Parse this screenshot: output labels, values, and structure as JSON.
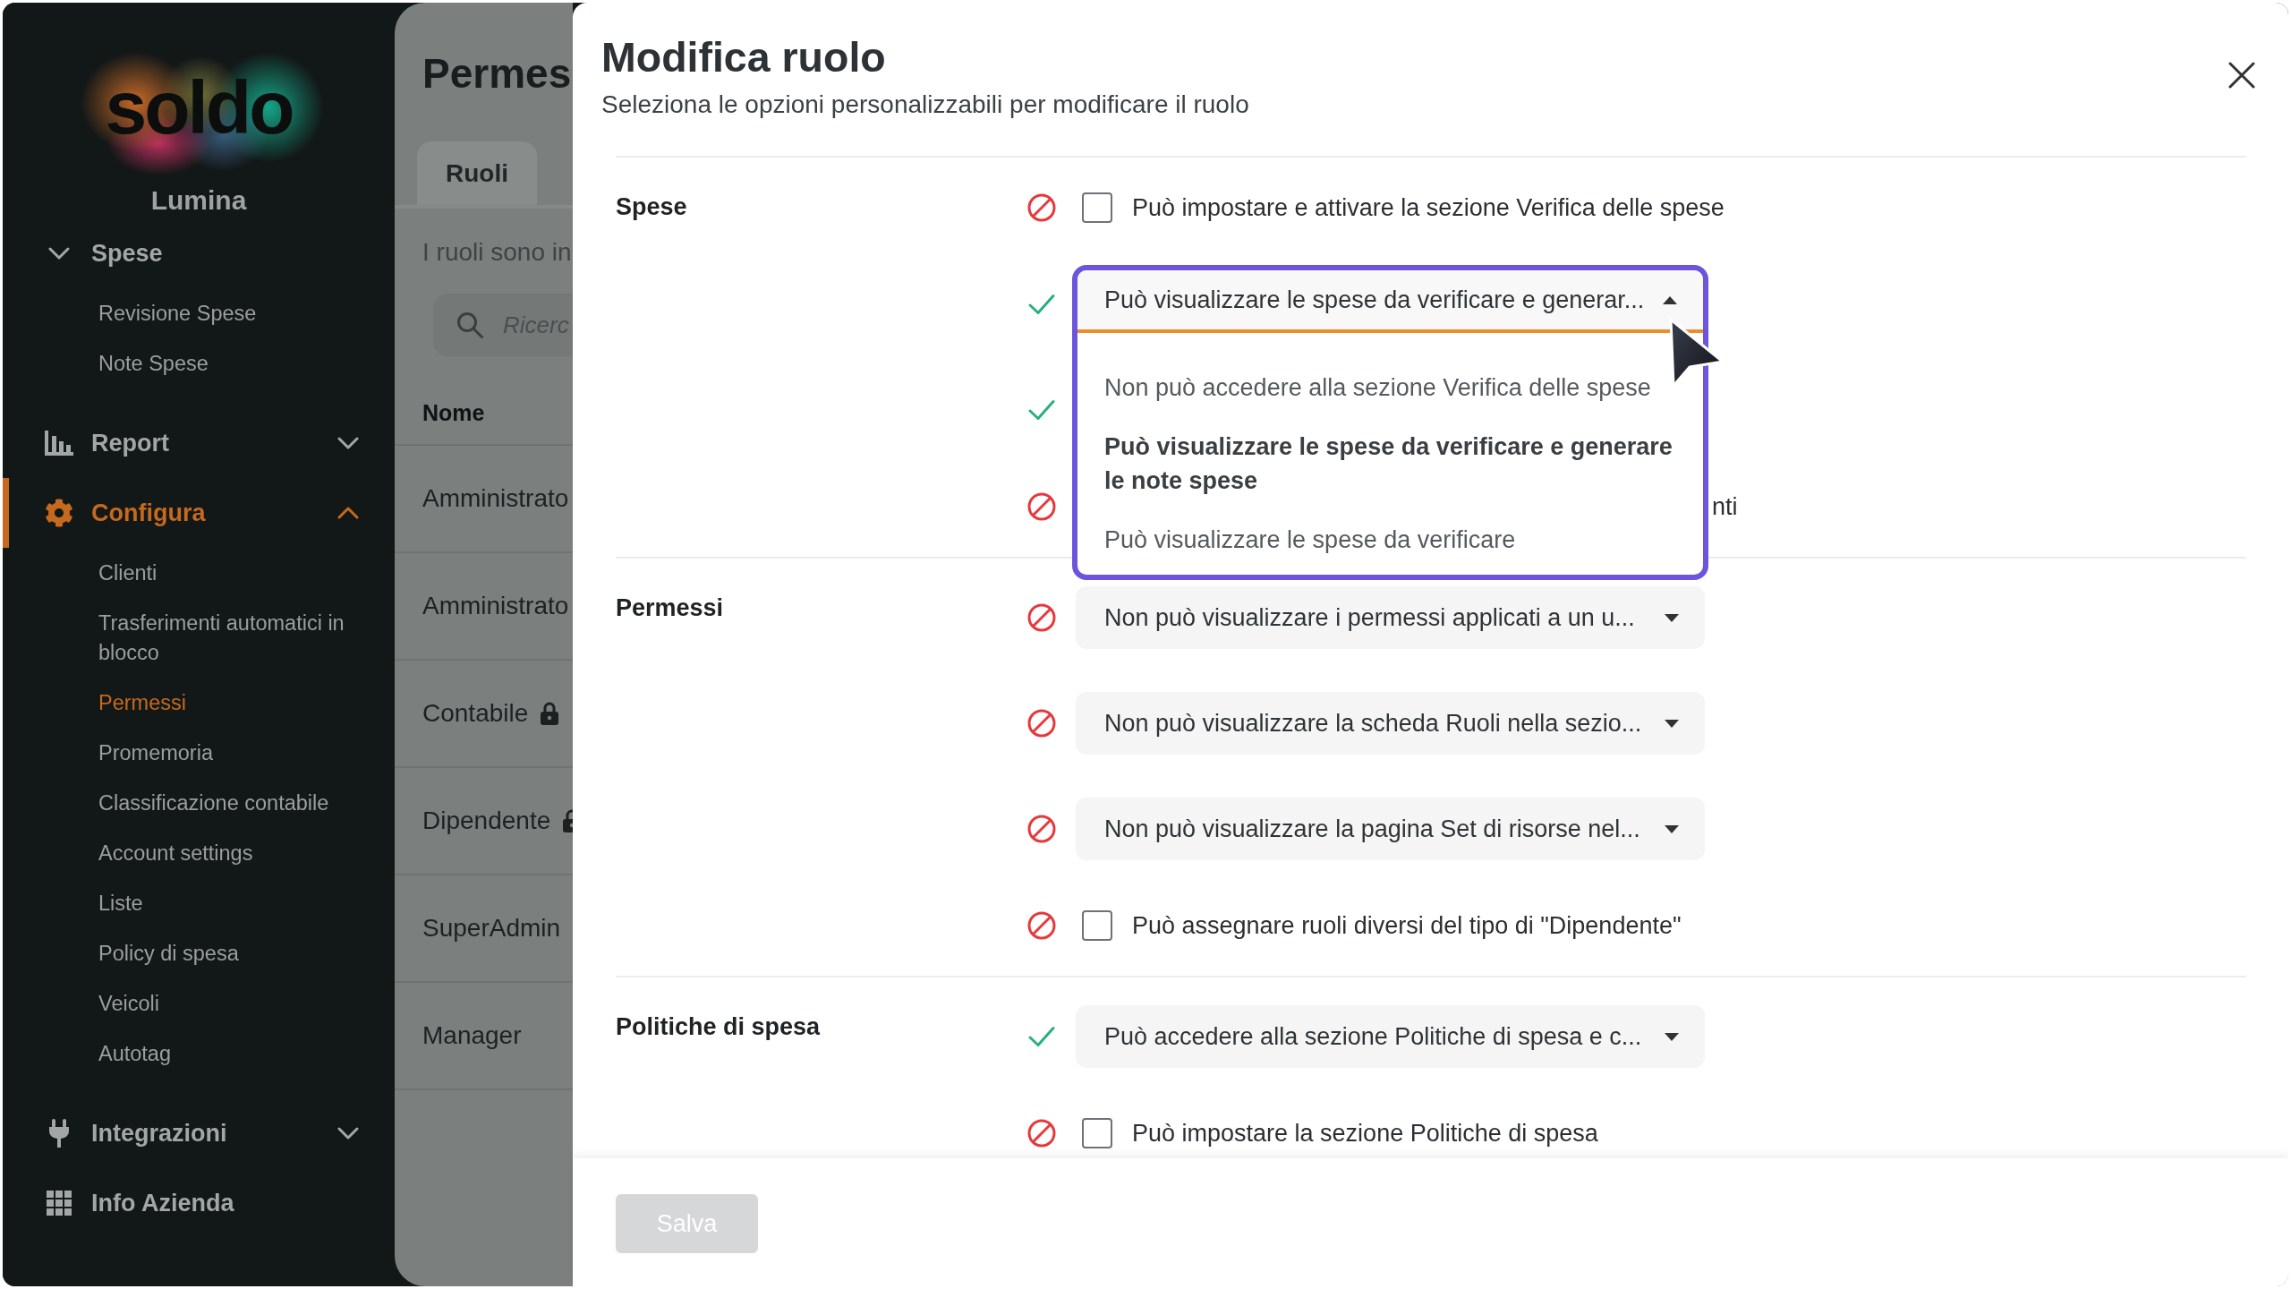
{
  "sidebar": {
    "logo": "soldo",
    "company": "Lumina",
    "groups": [
      {
        "label": "Spese",
        "selected": false,
        "children": [
          {
            "label": "Revisione Spese",
            "selected": false
          },
          {
            "label": "Note Spese",
            "selected": false
          }
        ]
      },
      {
        "label": "Report",
        "selected": false,
        "expanded": false
      },
      {
        "label": "Configura",
        "selected": true,
        "expanded": true,
        "children": [
          {
            "label": "Clienti",
            "selected": false
          },
          {
            "label": "Trasferimenti automatici in blocco",
            "selected": false
          },
          {
            "label": "Permessi",
            "selected": true
          },
          {
            "label": "Promemoria",
            "selected": false
          },
          {
            "label": "Classificazione contabile",
            "selected": false
          },
          {
            "label": "Account settings",
            "selected": false
          },
          {
            "label": "Liste",
            "selected": false
          },
          {
            "label": "Policy di spesa",
            "selected": false
          },
          {
            "label": "Veicoli",
            "selected": false
          },
          {
            "label": "Autotag",
            "selected": false
          }
        ]
      },
      {
        "label": "Integrazioni",
        "selected": false,
        "expanded": false
      },
      {
        "label": "Info Azienda",
        "selected": false
      }
    ]
  },
  "page": {
    "title": "Permes",
    "tabs": [
      {
        "label": "Ruoli",
        "selected": true
      }
    ],
    "description": "I ruoli sono in",
    "search": {
      "placeholder": "Ricerc"
    },
    "table": {
      "columns": [
        "Nome"
      ],
      "rows": [
        {
          "name": "Amministrato",
          "locked": false
        },
        {
          "name": "Amministrato",
          "locked": false
        },
        {
          "name": "Contabile",
          "locked": true
        },
        {
          "name": "Dipendente",
          "locked": true
        },
        {
          "name": "SuperAdmin",
          "locked": false
        },
        {
          "name": "Manager",
          "locked": false
        }
      ]
    }
  },
  "dialog": {
    "title": "Modifica ruolo",
    "subtitle": "Seleziona le opzioni personalizzabili per modificare il ruolo",
    "sections": [
      {
        "label": "Spese",
        "rows": [
          {
            "kind": "checkbox",
            "allowed": false,
            "checked": false,
            "label": "Può impostare e attivare la sezione Verifica delle spese"
          },
          {
            "kind": "select",
            "allowed": true,
            "open": true,
            "value": "Può visualizzare le spese da verificare e generar...",
            "options": [
              {
                "label": "Non può accedere alla sezione Verifica delle spese",
                "selected": false
              },
              {
                "label": "Può visualizzare le spese da verificare e generare le note spese",
                "selected": true
              },
              {
                "label": "Può visualizzare le spese da verificare",
                "selected": false
              }
            ]
          },
          {
            "kind": "covered",
            "allowed": true
          },
          {
            "kind": "partial",
            "allowed": false,
            "label": "nti"
          }
        ]
      },
      {
        "label": "Permessi",
        "rows": [
          {
            "kind": "select",
            "allowed": false,
            "open": false,
            "value": "Non può visualizzare i permessi applicati a un u..."
          },
          {
            "kind": "select",
            "allowed": false,
            "open": false,
            "value": "Non può visualizzare la scheda Ruoli nella sezio..."
          },
          {
            "kind": "select",
            "allowed": false,
            "open": false,
            "value": "Non può visualizzare la pagina Set di risorse nel..."
          },
          {
            "kind": "checkbox",
            "allowed": false,
            "checked": false,
            "label": "Può assegnare ruoli diversi del tipo di \"Dipendente\""
          }
        ]
      },
      {
        "label": "Politiche di spesa",
        "rows": [
          {
            "kind": "select",
            "allowed": true,
            "open": false,
            "value": "Può accedere alla sezione Politiche di spesa e c..."
          },
          {
            "kind": "checkbox",
            "allowed": false,
            "checked": false,
            "label": "Può impostare la sezione Politiche di spesa"
          }
        ]
      }
    ],
    "save_button": {
      "label": "Salva",
      "disabled": true
    }
  }
}
